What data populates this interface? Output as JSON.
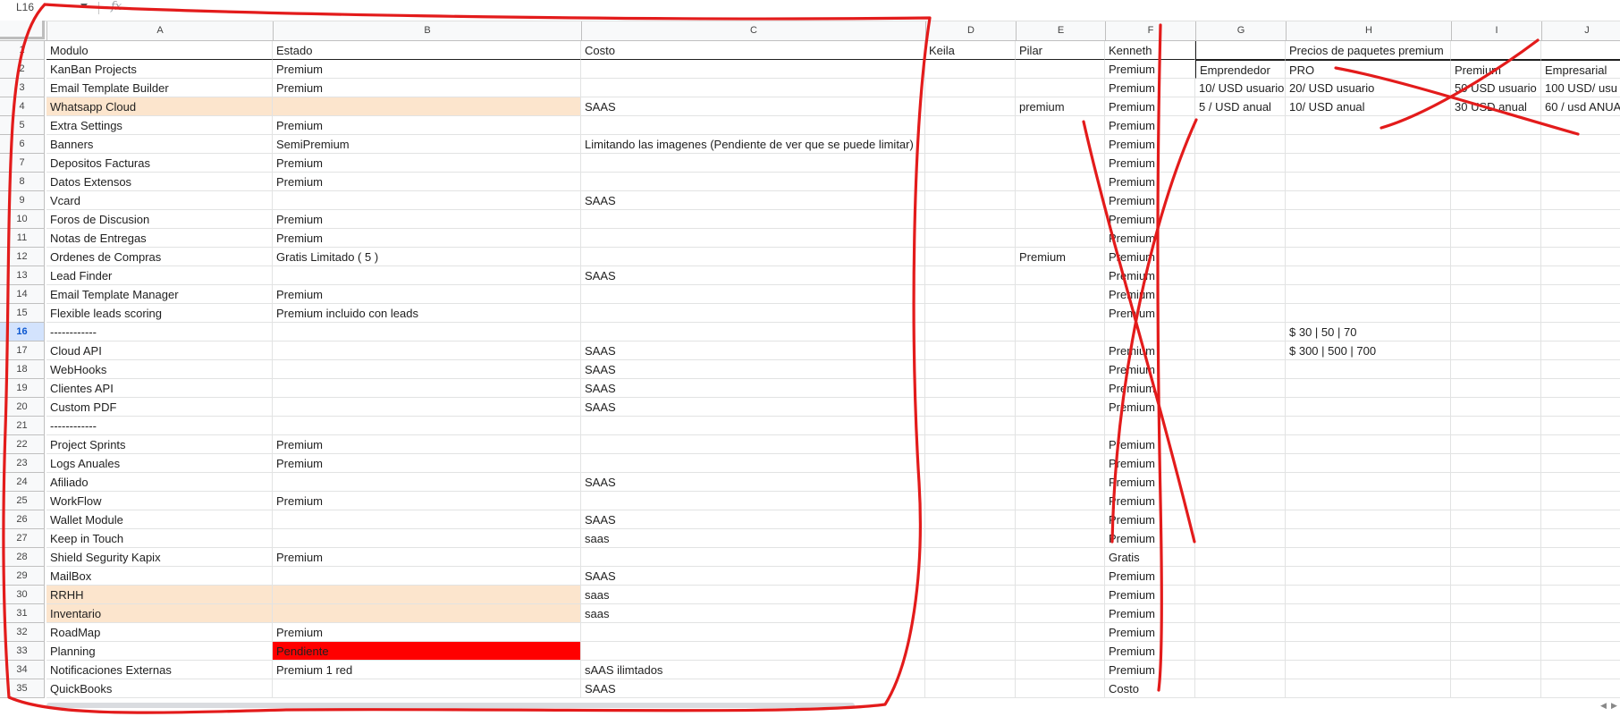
{
  "namebox": "L16",
  "fx_glyph": "fx",
  "columns": [
    "A",
    "B",
    "C",
    "D",
    "E",
    "F",
    "G",
    "H",
    "I",
    "J"
  ],
  "selected_row": 16,
  "rows": [
    {
      "n": 1,
      "c": [
        "Modulo",
        "Estado",
        "Costo",
        "Keila",
        "Pilar",
        "Kenneth",
        "",
        "Precios de paquetes premium",
        "",
        ""
      ]
    },
    {
      "n": 2,
      "c": [
        "KanBan Projects",
        "Premium",
        "",
        "",
        "",
        "Premium",
        "Emprendedor",
        "PRO",
        "Premium",
        "Empresarial"
      ]
    },
    {
      "n": 3,
      "c": [
        "Email Template Builder",
        "Premium",
        "",
        "",
        "",
        "Premium",
        "10/ USD usuario",
        "20/ USD usuario",
        "50 USD usuario",
        "100 USD/ usu"
      ]
    },
    {
      "n": 4,
      "c": [
        "Whatsapp Cloud",
        "",
        "SAAS",
        "",
        "premium",
        "Premium",
        "5 / USD anual",
        "10/ USD anual",
        "30 USD anual",
        "60 / usd ANUA"
      ],
      "fill": {
        "A": "orange",
        "B": "orange"
      }
    },
    {
      "n": 5,
      "c": [
        "Extra Settings",
        "Premium",
        "",
        "",
        "",
        "Premium",
        "",
        "",
        "",
        ""
      ]
    },
    {
      "n": 6,
      "c": [
        "Banners",
        "SemiPremium",
        "Limitando las imagenes (Pendiente de ver que se puede limitar)",
        "",
        "",
        "Premium",
        "",
        "",
        "",
        ""
      ]
    },
    {
      "n": 7,
      "c": [
        "Depositos Facturas",
        "Premium",
        "",
        "",
        "",
        "Premium",
        "",
        "",
        "",
        ""
      ]
    },
    {
      "n": 8,
      "c": [
        "Datos Extensos",
        "Premium",
        "",
        "",
        "",
        "Premium",
        "",
        "",
        "",
        ""
      ]
    },
    {
      "n": 9,
      "c": [
        "Vcard",
        "",
        "SAAS",
        "",
        "",
        "Premium",
        "",
        "",
        "",
        ""
      ]
    },
    {
      "n": 10,
      "c": [
        "Foros de Discusion",
        "Premium",
        "",
        "",
        "",
        "Premium",
        "",
        "",
        "",
        ""
      ]
    },
    {
      "n": 11,
      "c": [
        "Notas de Entregas",
        "Premium",
        "",
        "",
        "",
        "Premium",
        "",
        "",
        "",
        ""
      ]
    },
    {
      "n": 12,
      "c": [
        "Ordenes de Compras",
        "Gratis Limitado ( 5 )",
        "",
        "",
        "Premium",
        "Premium",
        "",
        "",
        "",
        ""
      ]
    },
    {
      "n": 13,
      "c": [
        "Lead Finder",
        "",
        "SAAS",
        "",
        "",
        "Premium",
        "",
        "",
        "",
        ""
      ]
    },
    {
      "n": 14,
      "c": [
        "Email Template Manager",
        "Premium",
        "",
        "",
        "",
        "Premium",
        "",
        "",
        "",
        ""
      ]
    },
    {
      "n": 15,
      "c": [
        "Flexible leads scoring",
        "Premium incluido con leads",
        "",
        "",
        "",
        "Premium",
        "",
        "",
        "",
        ""
      ]
    },
    {
      "n": 16,
      "c": [
        "------------",
        "",
        "",
        "",
        "",
        "",
        "",
        "$ 30 | 50 | 70",
        "",
        ""
      ]
    },
    {
      "n": 17,
      "c": [
        "Cloud API",
        "",
        "SAAS",
        "",
        "",
        "Premium",
        "",
        "$ 300 | 500 | 700",
        "",
        ""
      ]
    },
    {
      "n": 18,
      "c": [
        "WebHooks",
        "",
        "SAAS",
        "",
        "",
        "Premium",
        "",
        "",
        "",
        ""
      ]
    },
    {
      "n": 19,
      "c": [
        "Clientes API",
        "",
        "SAAS",
        "",
        "",
        "Premium",
        "",
        "",
        "",
        ""
      ]
    },
    {
      "n": 20,
      "c": [
        "Custom PDF",
        "",
        "SAAS",
        "",
        "",
        "Premium",
        "",
        "",
        "",
        ""
      ]
    },
    {
      "n": 21,
      "c": [
        "------------",
        "",
        "",
        "",
        "",
        "",
        "",
        "",
        "",
        ""
      ]
    },
    {
      "n": 22,
      "c": [
        "Project Sprints",
        "Premium",
        "",
        "",
        "",
        "Premium",
        "",
        "",
        "",
        ""
      ]
    },
    {
      "n": 23,
      "c": [
        "Logs Anuales",
        "Premium",
        "",
        "",
        "",
        "Premium",
        "",
        "",
        "",
        ""
      ]
    },
    {
      "n": 24,
      "c": [
        "Afiliado",
        "",
        "SAAS",
        "",
        "",
        "Premium",
        "",
        "",
        "",
        ""
      ]
    },
    {
      "n": 25,
      "c": [
        "WorkFlow",
        "Premium",
        "",
        "",
        "",
        "Premium",
        "",
        "",
        "",
        ""
      ]
    },
    {
      "n": 26,
      "c": [
        "Wallet Module",
        "",
        "SAAS",
        "",
        "",
        "Premium",
        "",
        "",
        "",
        ""
      ]
    },
    {
      "n": 27,
      "c": [
        "Keep in Touch",
        "",
        "saas",
        "",
        "",
        "Premium",
        "",
        "",
        "",
        ""
      ]
    },
    {
      "n": 28,
      "c": [
        "Shield Segurity Kapix",
        "Premium",
        "",
        "",
        "",
        "Gratis",
        "",
        "",
        "",
        ""
      ]
    },
    {
      "n": 29,
      "c": [
        "MailBox",
        "",
        "SAAS",
        "",
        "",
        "Premium",
        "",
        "",
        "",
        ""
      ]
    },
    {
      "n": 30,
      "c": [
        "RRHH",
        "",
        "saas",
        "",
        "",
        "Premium",
        "",
        "",
        "",
        ""
      ],
      "fill": {
        "A": "orange",
        "B": "orange"
      }
    },
    {
      "n": 31,
      "c": [
        "Inventario",
        "",
        "saas",
        "",
        "",
        "Premium",
        "",
        "",
        "",
        ""
      ],
      "fill": {
        "A": "orange",
        "B": "orange"
      }
    },
    {
      "n": 32,
      "c": [
        "RoadMap",
        "Premium",
        "",
        "",
        "",
        "Premium",
        "",
        "",
        "",
        ""
      ]
    },
    {
      "n": 33,
      "c": [
        "Planning",
        "Pendiente",
        "",
        "",
        "",
        "Premium",
        "",
        "",
        "",
        ""
      ],
      "fill": {
        "B": "red"
      }
    },
    {
      "n": 34,
      "c": [
        "Notificaciones Externas",
        "Premium 1 red",
        "sAAS ilimtados",
        "",
        "",
        "Premium",
        "",
        "",
        "",
        ""
      ]
    },
    {
      "n": 35,
      "c": [
        "QuickBooks",
        "",
        "SAAS",
        "",
        "",
        "Costo",
        "",
        "",
        "",
        ""
      ]
    }
  ],
  "colors": {
    "accent": "#0b57d0",
    "orange_fill": "#fce5cd",
    "red_fill": "#ff0000",
    "ink": "#e31b1b"
  }
}
